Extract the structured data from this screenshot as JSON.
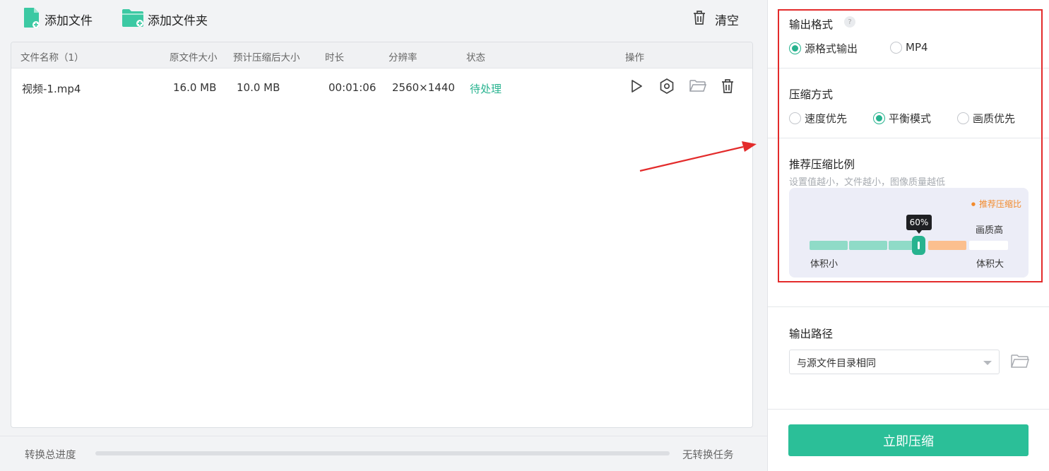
{
  "toolbar": {
    "add_file": "添加文件",
    "add_folder": "添加文件夹",
    "clear": "清空"
  },
  "table": {
    "headers": {
      "name": "文件名称（1）",
      "orig_size": "原文件大小",
      "est_size": "预计压缩后大小",
      "duration": "时长",
      "resolution": "分辨率",
      "status": "状态",
      "actions": "操作"
    },
    "rows": [
      {
        "name": "视频-1.mp4",
        "orig_size": "16.0 MB",
        "est_size": "10.0 MB",
        "duration": "00:01:06",
        "resolution": "2560×1440",
        "status": "待处理"
      }
    ]
  },
  "progress": {
    "label": "转换总进度",
    "value": 0,
    "status": "无转换任务"
  },
  "settings": {
    "output_format": {
      "title": "输出格式",
      "help": "?",
      "options": [
        "源格式输出",
        "MP4"
      ],
      "selected": "源格式输出"
    },
    "compress_mode": {
      "title": "压缩方式",
      "options": [
        "速度优先",
        "平衡模式",
        "画质优先"
      ],
      "selected": "平衡模式"
    },
    "ratio": {
      "title": "推荐压缩比例",
      "hint": "设置值越小，文件越小，图像质量越低",
      "legend": "推荐压缩比",
      "value_label": "60%",
      "value": 60,
      "top_right_label": "画质高",
      "min_label": "体积小",
      "max_label": "体积大"
    },
    "output_path": {
      "title": "输出路径",
      "value": "与源文件目录相同"
    },
    "compress_button": "立即压缩"
  },
  "colors": {
    "accent": "#2bbf98",
    "status_green": "#27b38f",
    "recommend_orange": "#f28a2c",
    "highlight_red": "#e32b2b"
  }
}
